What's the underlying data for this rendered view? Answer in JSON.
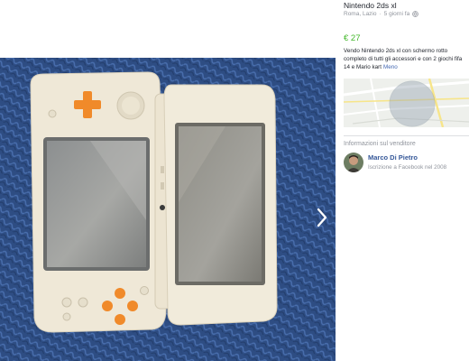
{
  "listing": {
    "title": "Nintendo 2ds xl",
    "location": "Roma, Lazio",
    "posted": "5 giorni fa",
    "separator": "·",
    "price": "€ 27",
    "description": "Vendo Nintendo 2ds xl con schermo rotto completo di tutti gli accessori e con 2 giochi fifa 14 e Mario kart",
    "more_label": "Meno",
    "map_caption": "Google"
  },
  "seller": {
    "heading": "Informazioni sul venditore",
    "name": "Marco Di Pietro",
    "member_since": "Iscrizione a Facebook nel 2008"
  },
  "icons": {
    "visibility": "globe-icon",
    "next": "chevron-right-icon",
    "map_pin": "map-pin-icon"
  },
  "colors": {
    "price": "#42b72a",
    "link": "#4267b2",
    "seller_name": "#365899",
    "muted": "#90949c",
    "text": "#1d2129",
    "console_accent": "#f28c28",
    "photo_background": "#2f4f86"
  }
}
